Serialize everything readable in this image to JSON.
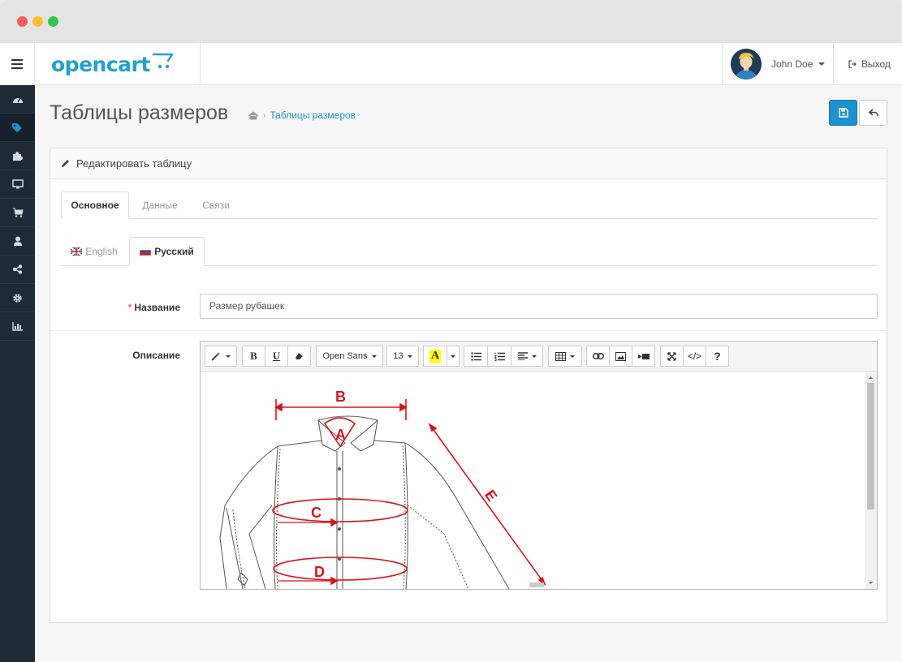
{
  "window": {
    "controls": [
      "close",
      "minimize",
      "maximize"
    ]
  },
  "header": {
    "logo_text": "opencart",
    "user_name": "John Doe",
    "logout_label": "Выход",
    "menu_icon": "hamburger-icon"
  },
  "sidebar": {
    "items": [
      {
        "icon": "dashboard-icon",
        "active": false
      },
      {
        "icon": "tags-icon",
        "active": true
      },
      {
        "icon": "puzzle-icon",
        "active": false
      },
      {
        "icon": "desktop-icon",
        "active": false
      },
      {
        "icon": "cart-icon",
        "active": false
      },
      {
        "icon": "user-icon",
        "active": false
      },
      {
        "icon": "share-icon",
        "active": false
      },
      {
        "icon": "cog-icon",
        "active": false
      },
      {
        "icon": "bar-chart-icon",
        "active": false
      }
    ]
  },
  "page": {
    "title": "Таблицы размеров",
    "breadcrumb": {
      "home_icon": "home-icon",
      "current": "Таблицы размеров"
    },
    "save_icon": "floppy-icon",
    "back_icon": "reply-icon"
  },
  "panel": {
    "heading": "Редактировать таблицу",
    "tabs": [
      "Основное",
      "Данные",
      "Связи"
    ],
    "active_tab": "Основное",
    "languages": [
      "English",
      "Русский"
    ],
    "active_language": "Русский"
  },
  "form": {
    "name_label": "Название",
    "name_required_mark": "*",
    "name_value": "Размер рубашек",
    "description_label": "Описание"
  },
  "editor": {
    "font_family": "Open Sans",
    "font_size": "13",
    "bold_label": "B",
    "underline_label": "U",
    "text_color_label": "A",
    "help_label": "?",
    "code_label": "</>",
    "diagram_labels": [
      "A",
      "B",
      "C",
      "D",
      "E"
    ],
    "accent_color": "#d9141a"
  },
  "colors": {
    "brand": "#23a1d1",
    "primary_button": "#1e91cf",
    "sidebar": "#1f2a37",
    "required": "#f56b6b"
  }
}
